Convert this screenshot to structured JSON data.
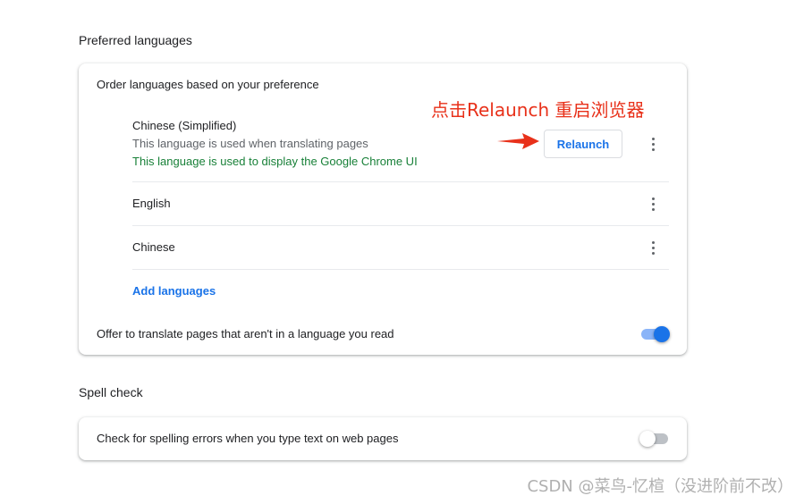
{
  "languages_section": {
    "title": "Preferred languages",
    "order_label": "Order languages based on your preference",
    "languages": [
      {
        "name": "Chinese (Simplified)",
        "note_translate": "This language is used when translating pages",
        "note_display": "This language is used to display the Google Chrome UI",
        "relaunch_label": "Relaunch"
      },
      {
        "name": "English"
      },
      {
        "name": "Chinese"
      }
    ],
    "add_languages": "Add languages",
    "offer_translate": {
      "label": "Offer to translate pages that aren't in a language you read",
      "enabled": true
    }
  },
  "spellcheck_section": {
    "title": "Spell check",
    "check_spelling": {
      "label": "Check for spelling errors when you type text on web pages",
      "enabled": false
    }
  },
  "annotation": {
    "text": "点击Relaunch 重启浏览器",
    "color": "#e8311a"
  },
  "watermark": "CSDN @菜鸟-忆楦（没进阶前不改）",
  "colors": {
    "accent": "#1a73e8",
    "green_note": "#188038"
  },
  "icons": [
    "more-vert-icon",
    "red-arrow-icon"
  ]
}
